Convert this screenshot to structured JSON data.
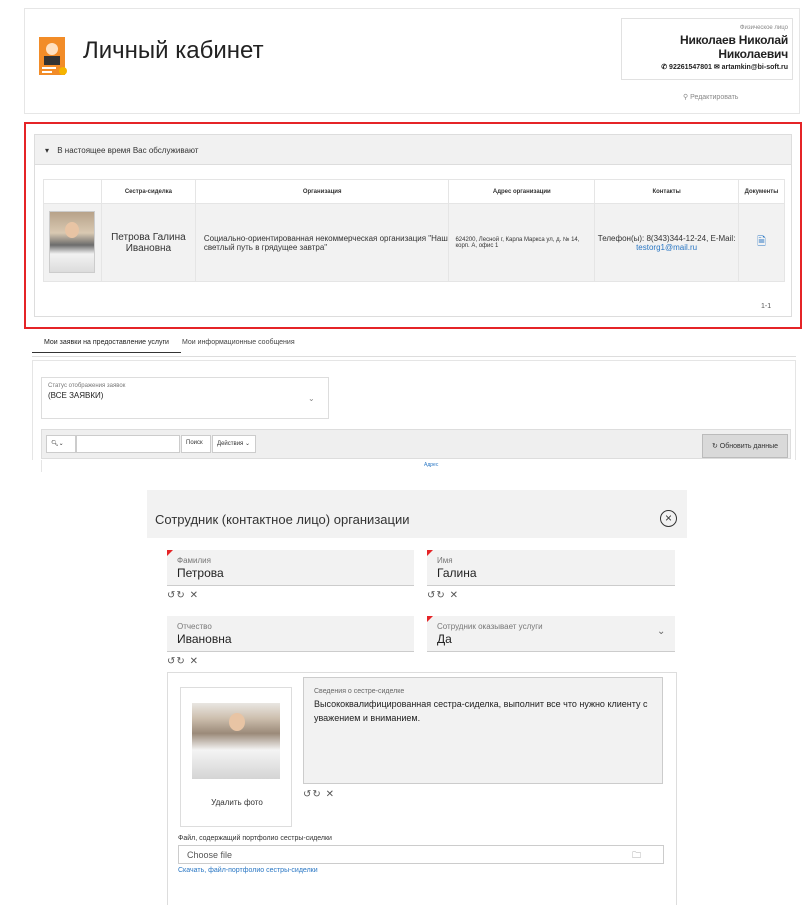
{
  "header": {
    "title": "Личный кабинет",
    "user_type": "Физическое лицо",
    "user_name": "Николаев Николай Николаевич",
    "user_phone": "92261547801",
    "user_email": "artamkin@bi-soft.ru",
    "edit_label": "Редактировать"
  },
  "served": {
    "section_title": "В настоящее время Вас обслуживают",
    "columns": [
      "",
      "Сестра-сиделка",
      "Организация",
      "Адрес организации",
      "Контакты",
      "Документы"
    ],
    "row": {
      "nurse": "Петрова Галина Ивановна",
      "organization": "Социально-ориентированная некоммерческая организация \"Наш светлый путь в грядущее завтра\"",
      "address": "624200, Лесной г, Карла Маркса ул, д. № 14, корп. А, офис 1",
      "contacts_phone": "Телефон(ы): 8(343)344-12-24, E-Mail:",
      "contacts_email": "testorg1@mail.ru"
    },
    "pager": "1-1"
  },
  "tabs": {
    "tab1": "Мои заявки на предоставление услуги",
    "tab2": "Мои информационные сообщения"
  },
  "requests": {
    "status_label": "Статус отображения заявок",
    "status_value": "(ВСЕ ЗАЯВКИ)",
    "search_label": "Поиск",
    "actions_label": "Действия",
    "refresh_label": "Обновить данные",
    "partial_header": "Адрес"
  },
  "modal": {
    "title": "Сотрудник (контактное лицо) организации",
    "surname_label": "Фамилия",
    "surname_value": "Петрова",
    "name_label": "Имя",
    "name_value": "Галина",
    "patronymic_label": "Отчество",
    "patronymic_value": "Ивановна",
    "provides_label": "Сотрудник оказывает услуги",
    "provides_value": "Да",
    "delete_photo": "Удалить фото",
    "about_label": "Сведения о сестре-сиделке",
    "about_value": "Высококвалифицированная сестра-сиделка, выполнит все что нужно клиенту с уважением и вниманием.",
    "file_label": "Файл, содержащий портфолио сестры-сиделки",
    "file_placeholder": "Choose file",
    "download_link": "Скачать, файл-портфолио сестры-сиделки"
  },
  "colors": {
    "highlight_border": "#e52427",
    "link": "#2a77c4",
    "panel_bg": "#f2f2f2"
  }
}
